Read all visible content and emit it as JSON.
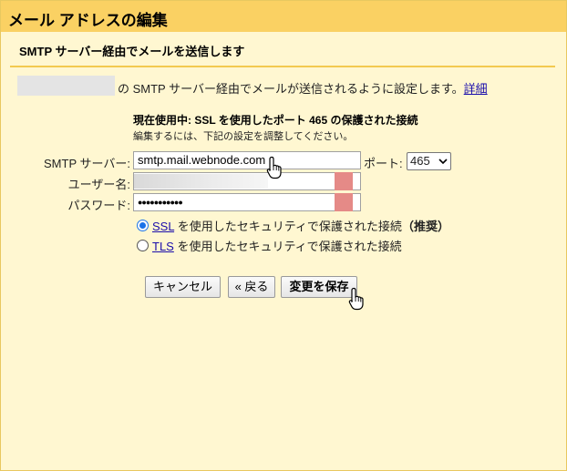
{
  "dialog": {
    "title": "メール アドレスの編集",
    "subheader": "SMTP サーバー経由でメールを送信します"
  },
  "intro": {
    "text": "の SMTP サーバー経由でメールが送信されるように設定します。",
    "link": "詳細"
  },
  "status": {
    "current": "現在使用中: SSL を使用したポート 465 の保護された接続",
    "adjust": "編集するには、下記の設定を調整してください。"
  },
  "form": {
    "smtp_label": "SMTP サーバー:",
    "smtp_value": "smtp.mail.webnode.com",
    "port_label": "ポート:",
    "port_value": "465",
    "username_label": "ユーザー名:",
    "password_label": "パスワード:",
    "password_value": "●●●●●●●●●●●"
  },
  "security": {
    "ssl_link": "SSL",
    "ssl_text": " を使用したセキュリティで保護された接続",
    "ssl_recommended": "（推奨）",
    "tls_link": "TLS",
    "tls_text": " を使用したセキュリティで保護された接続",
    "selected": "SSL"
  },
  "buttons": {
    "cancel": "キャンセル",
    "back": "« 戻る",
    "save": "変更を保存"
  },
  "colors": {
    "title_bar": "#fad163",
    "panel": "#fff7d1",
    "link": "#1a0dab",
    "redaction_pink": "#e58a87"
  }
}
